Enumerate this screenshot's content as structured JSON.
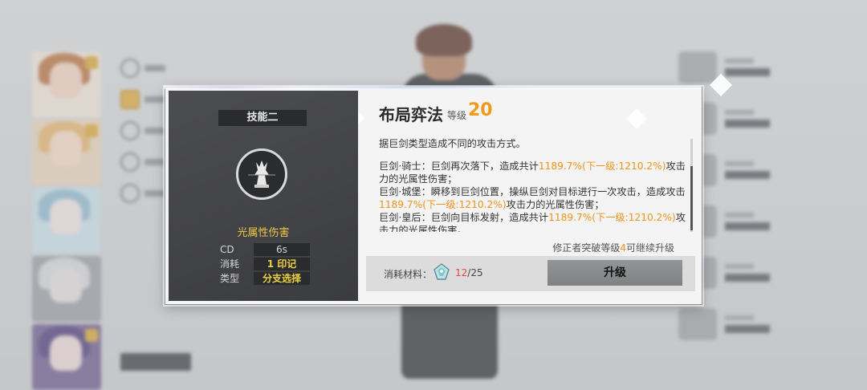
{
  "skill_panel": {
    "skill_tag": "技能二",
    "damage_type": "光属性伤害",
    "stats": [
      {
        "key": "CD",
        "value": "6s",
        "highlight": false
      },
      {
        "key": "消耗",
        "value": "1 印记",
        "highlight": true
      },
      {
        "key": "类型",
        "value": "分支选择",
        "highlight": true
      }
    ]
  },
  "detail": {
    "title": "布局弈法",
    "level_label": "等级",
    "level_value": "20",
    "intro": "据巨剑类型造成不同的攻击方式。",
    "lines": [
      {
        "pre": "巨剑·骑士：巨剑再次落下，造成共计",
        "hl": "1189.7%(下一级:1210.2%)",
        "post": "攻击力的光属性伤害；"
      },
      {
        "pre": "巨剑·城堡：瞬移到巨剑位置，操纵巨剑对目标进行一次攻击，造成攻击",
        "hl": "1189.7%(下一级:1210.2%)",
        "post": "攻击力的光属性伤害；"
      },
      {
        "pre": "巨剑·皇后：巨剑向目标发射，造成共计",
        "hl": "1189.7%(下一级:1210.2%)",
        "post": "攻击力的光属性伤害。"
      }
    ],
    "upgrade_note_pre": "修正者突破等级",
    "upgrade_note_num": "4",
    "upgrade_note_post": "可继续升级",
    "cost_label": "消耗材料：",
    "cost_current": "12",
    "cost_total": "/25",
    "upgrade_button": "升级"
  },
  "colors": {
    "highlight_orange": "#f0921a",
    "level_orange": "#f09a1a",
    "stat_yellow": "#f0d33e",
    "cost_red": "#e0473a"
  }
}
